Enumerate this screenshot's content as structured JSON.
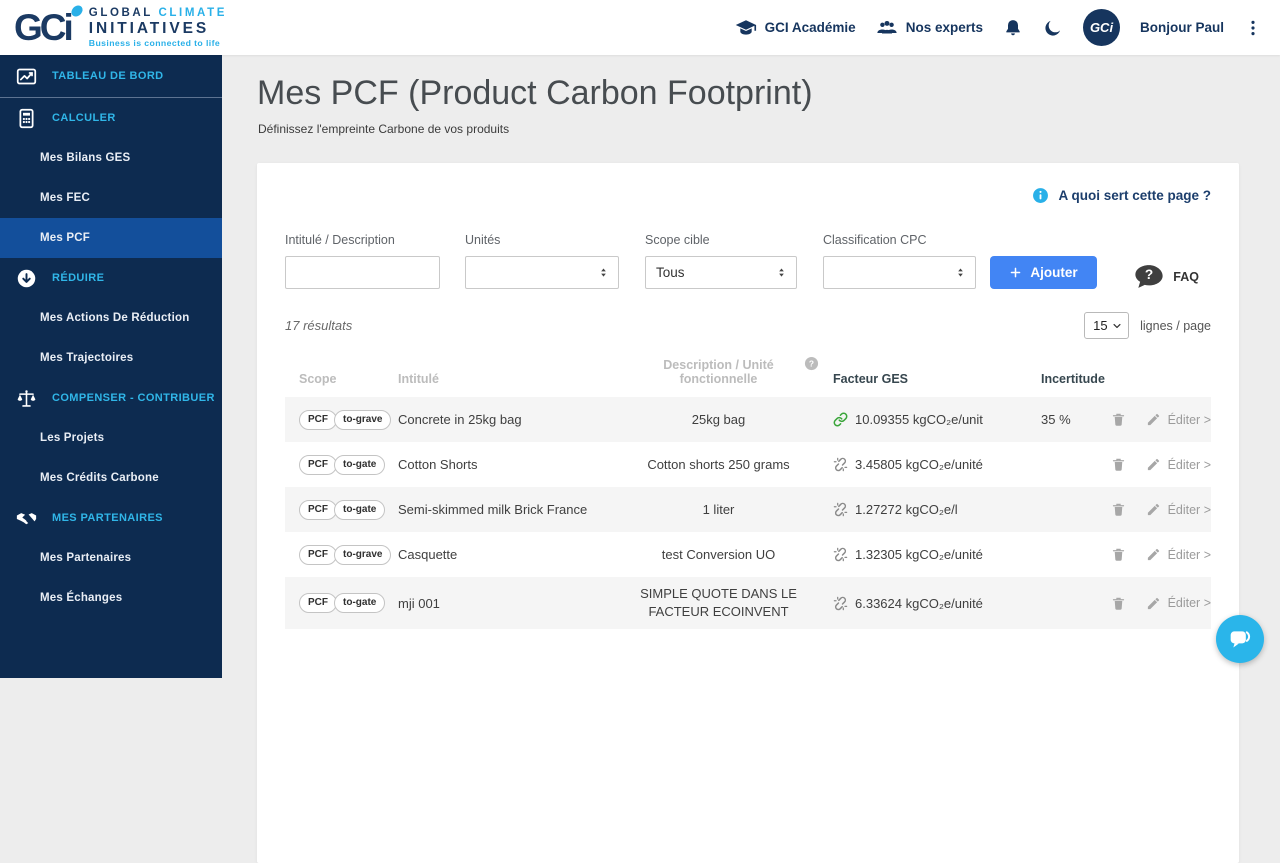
{
  "header": {
    "logo": {
      "mark": "GC",
      "mark_i": "i",
      "word1": "GLOBAL",
      "word2": "CLIMATE",
      "word3": "INITIATIVES",
      "tagline": "Business is connected to life"
    },
    "academie_label": "GCI Académie",
    "experts_label": "Nos experts",
    "avatar_text": "GCi",
    "greeting": "Bonjour Paul"
  },
  "sidebar": {
    "sections": [
      {
        "label": "TABLEAU DE BORD",
        "items": []
      },
      {
        "label": "CALCULER",
        "items": [
          "Mes Bilans GES",
          "Mes FEC",
          "Mes PCF"
        ]
      },
      {
        "label": "RÉDUIRE",
        "items": [
          "Mes Actions De Réduction",
          "Mes Trajectoires"
        ]
      },
      {
        "label": "COMPENSER - CONTRIBUER",
        "items": [
          "Les Projets",
          "Mes Crédits Carbone"
        ]
      },
      {
        "label": "MES PARTENAIRES",
        "items": [
          "Mes Partenaires",
          "Mes Échanges"
        ]
      }
    ],
    "active_item": "Mes PCF"
  },
  "page": {
    "title": "Mes PCF (Product Carbon Footprint)",
    "subtitle": "Définissez l'empreinte Carbone de vos produits",
    "info_link": "A quoi sert cette page ?"
  },
  "filters": {
    "intitule_label": "Intitulé / Description",
    "intitule_value": "",
    "unites_label": "Unités",
    "unites_value": "",
    "scope_label": "Scope cible",
    "scope_value": "Tous",
    "cpc_label": "Classification CPC",
    "cpc_value": "",
    "add_button": "Ajouter",
    "faq_label": "FAQ"
  },
  "results": {
    "count_text": "17 résultats",
    "per_page_value": "15",
    "per_page_label": "lignes / page"
  },
  "table": {
    "headers": {
      "scope": "Scope",
      "intitule": "Intitulé",
      "description": "Description / Unité fonctionnelle",
      "facteur": "Facteur GES",
      "incertitude": "Incertitude"
    },
    "edit_label": "Éditer >",
    "rows": [
      {
        "tag1": "PCF",
        "tag2": "to-grave",
        "intitule": "Concrete in 25kg bag",
        "description": "25kg bag",
        "facteur": "10.09355 kgCO₂e/unit",
        "link_state": "linked",
        "incertitude": "35 %"
      },
      {
        "tag1": "PCF",
        "tag2": "to-gate",
        "intitule": "Cotton Shorts",
        "description": "Cotton shorts 250 grams",
        "facteur": "3.45805 kgCO₂e/unité",
        "link_state": "unlinked",
        "incertitude": ""
      },
      {
        "tag1": "PCF",
        "tag2": "to-gate",
        "intitule": "Semi-skimmed milk Brick France",
        "description": "1 liter",
        "facteur": "1.27272 kgCO₂e/l",
        "link_state": "unlinked",
        "incertitude": ""
      },
      {
        "tag1": "PCF",
        "tag2": "to-grave",
        "intitule": "Casquette",
        "description": "test Conversion UO",
        "facteur": "1.32305 kgCO₂e/unité",
        "link_state": "unlinked",
        "incertitude": ""
      },
      {
        "tag1": "PCF",
        "tag2": "to-gate",
        "intitule": "mji 001",
        "description": "SIMPLE QUOTE DANS LE FACTEUR ECOINVENT",
        "facteur": "6.33624 kgCO₂e/unité",
        "link_state": "unlinked",
        "incertitude": ""
      }
    ]
  },
  "colors": {
    "sidebar_navy": "#0d2b50",
    "active_blue": "#134f9b",
    "cyan": "#30b6e8",
    "brand_navy": "#1b3a63",
    "accent_blue": "#4285f4",
    "green_link": "#3aa53a",
    "chat_blue": "#2ab5ea",
    "stripe_gray": "#f5f5f5"
  },
  "icons": {
    "dashboard-icon": "line-chart-box",
    "calculator-icon": "calculator",
    "reduce-icon": "arrow-down-circle",
    "offset-icon": "balance-scale",
    "partners-icon": "handshake",
    "graduation-cap-icon": "graduation-cap",
    "users-icon": "user-group",
    "bell-icon": "bell",
    "moon-icon": "crescent-moon",
    "kebab-icon": "vertical-dots",
    "info-icon": "info-circle",
    "faq-icon": "question-speech-bubble",
    "help-icon": "question-circle",
    "link-icon": "chain-link",
    "unlink-icon": "broken-chain",
    "trash-icon": "trash-can",
    "edit-pencil-icon": "pencil",
    "chat-icon": "chat-bubbles",
    "select-arrows-icon": "up-down-triangles",
    "chevron-down-icon": "chevron-down",
    "plus-icon": "plus"
  }
}
